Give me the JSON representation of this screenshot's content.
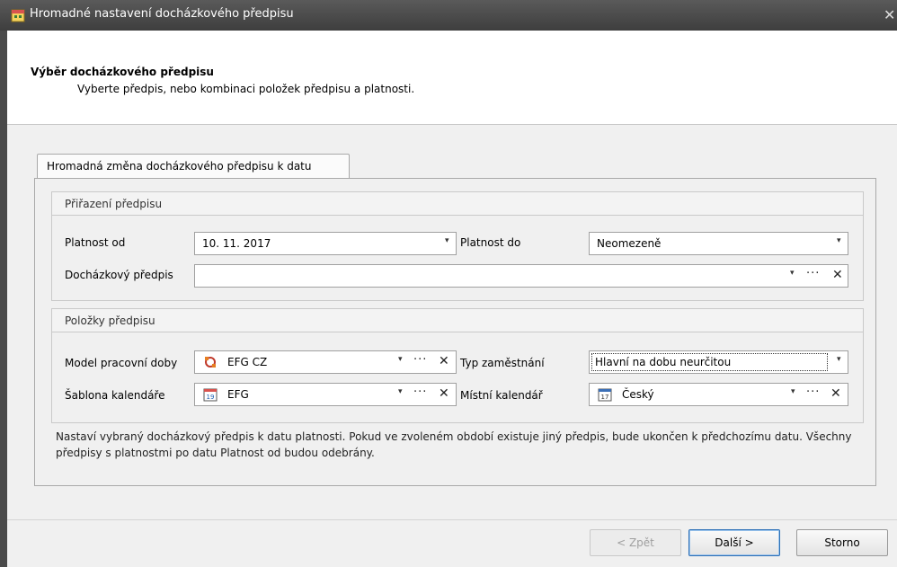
{
  "window": {
    "title": "Hromadné nastavení docházkového předpisu"
  },
  "header": {
    "title": "Výběr docházkového předpisu",
    "subtitle": "Vyberte předpis, nebo kombinaci položek předpisu a platnosti."
  },
  "tab": {
    "label": "Hromadná změna docházkového předpisu k datu"
  },
  "assignment": {
    "heading": "Přiřazení předpisu",
    "valid_from_label": "Platnost od",
    "valid_from_value": "10. 11. 2017",
    "valid_to_label": "Platnost do",
    "valid_to_value": "Neomezeně",
    "rule_label": "Docházkový předpis",
    "rule_value": ""
  },
  "items": {
    "heading": "Položky předpisu",
    "work_model_label": "Model pracovní doby",
    "work_model_value": "EFG CZ",
    "employment_type_label": "Typ zaměstnání",
    "employment_type_value": "Hlavní na dobu neurčitou",
    "calendar_template_label": "Šablona kalendáře",
    "calendar_template_value": "EFG",
    "local_calendar_label": "Místní kalendář",
    "local_calendar_value": "Český"
  },
  "note": "Nastaví vybraný docházkový předpis k datu platnosti. Pokud ve zvoleném období existuje jiný předpis, bude ukončen k předchozímu datu. Všechny předpisy s platnostmi po datu Platnost od budou odebrány.",
  "buttons": {
    "back": "< Zpět",
    "next": "Další >",
    "cancel": "Storno"
  },
  "icons": {
    "dropdown": "▾",
    "ellipsis": "···",
    "clear": "✕",
    "close": "✕"
  },
  "colors": {
    "titlebar": "#4a4a4a",
    "default_button_border": "#2b6fb6"
  }
}
